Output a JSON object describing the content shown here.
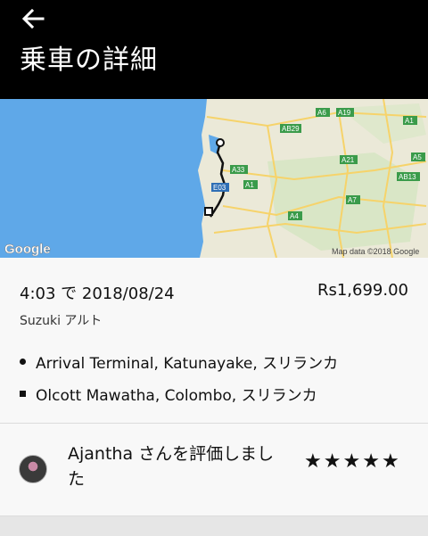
{
  "header": {
    "back_icon": "arrow-left-icon",
    "title": "乗車の詳細"
  },
  "map": {
    "logo": "Google",
    "attribution": "Map data ©2018 Google",
    "road_labels": [
      "A6",
      "A19",
      "A1",
      "AB29",
      "A33",
      "A21",
      "A5",
      "AB13",
      "E03",
      "A1",
      "A7",
      "A4"
    ],
    "colors": {
      "sea": "#5fa8e8",
      "land": "#ebe9d8",
      "route": "#111111"
    }
  },
  "trip": {
    "datetime": "4:03 で 2018/08/24",
    "fare": "Rs1,699.00",
    "vehicle": "Suzuki アルト",
    "pickup": "Arrival Terminal, Katunayake, スリランカ",
    "dropoff": "Olcott Mawatha, Colombo, スリランカ"
  },
  "rating": {
    "text": "Ajantha さんを評価しました",
    "stars": 5,
    "star_glyph": "★"
  }
}
